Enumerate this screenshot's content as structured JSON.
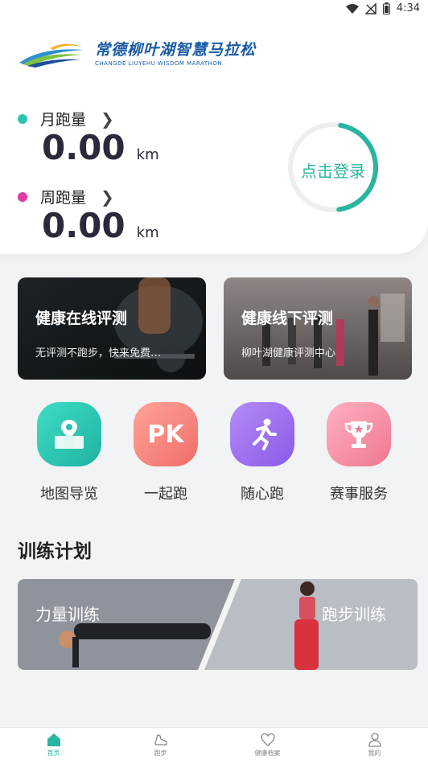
{
  "status_bar": {
    "time": "4:34"
  },
  "header": {
    "logo_cn": "常德柳叶湖智慧马拉松",
    "logo_en": "CHANGDE LIUYEHU WISDOM MARATHON"
  },
  "stats": [
    {
      "label": "月跑量",
      "value": "0.00",
      "unit": "km",
      "dot_color": "#2cc3b0"
    },
    {
      "label": "周跑量",
      "value": "0.00",
      "unit": "km",
      "dot_color": "#e23aa6"
    }
  ],
  "login": {
    "label": "点击登录",
    "progress": 0.45
  },
  "health_cards": [
    {
      "title": "健康在线评测",
      "subtitle": "无评测不跑步，快来免费…"
    },
    {
      "title": "健康线下评测",
      "subtitle": "柳叶湖健康评测中心"
    }
  ],
  "features": [
    {
      "label": "地图导览",
      "icon": "map-icon"
    },
    {
      "label": "一起跑",
      "icon": "pk-icon",
      "icon_text": "PK"
    },
    {
      "label": "随心跑",
      "icon": "running-person-icon"
    },
    {
      "label": "赛事服务",
      "icon": "trophy-icon"
    }
  ],
  "training": {
    "title": "训练计划",
    "left_label": "力量训练",
    "right_label": "跑步训练"
  },
  "bottom_nav": [
    {
      "label": "首页",
      "icon": "home-icon",
      "active": true
    },
    {
      "label": "跑步",
      "icon": "shoe-icon",
      "active": false
    },
    {
      "label": "健康档案",
      "icon": "heart-icon",
      "active": false
    },
    {
      "label": "我的",
      "icon": "profile-icon",
      "active": false
    }
  ],
  "colors": {
    "accent": "#2ab5a0",
    "ring_track": "#eeeeee"
  }
}
